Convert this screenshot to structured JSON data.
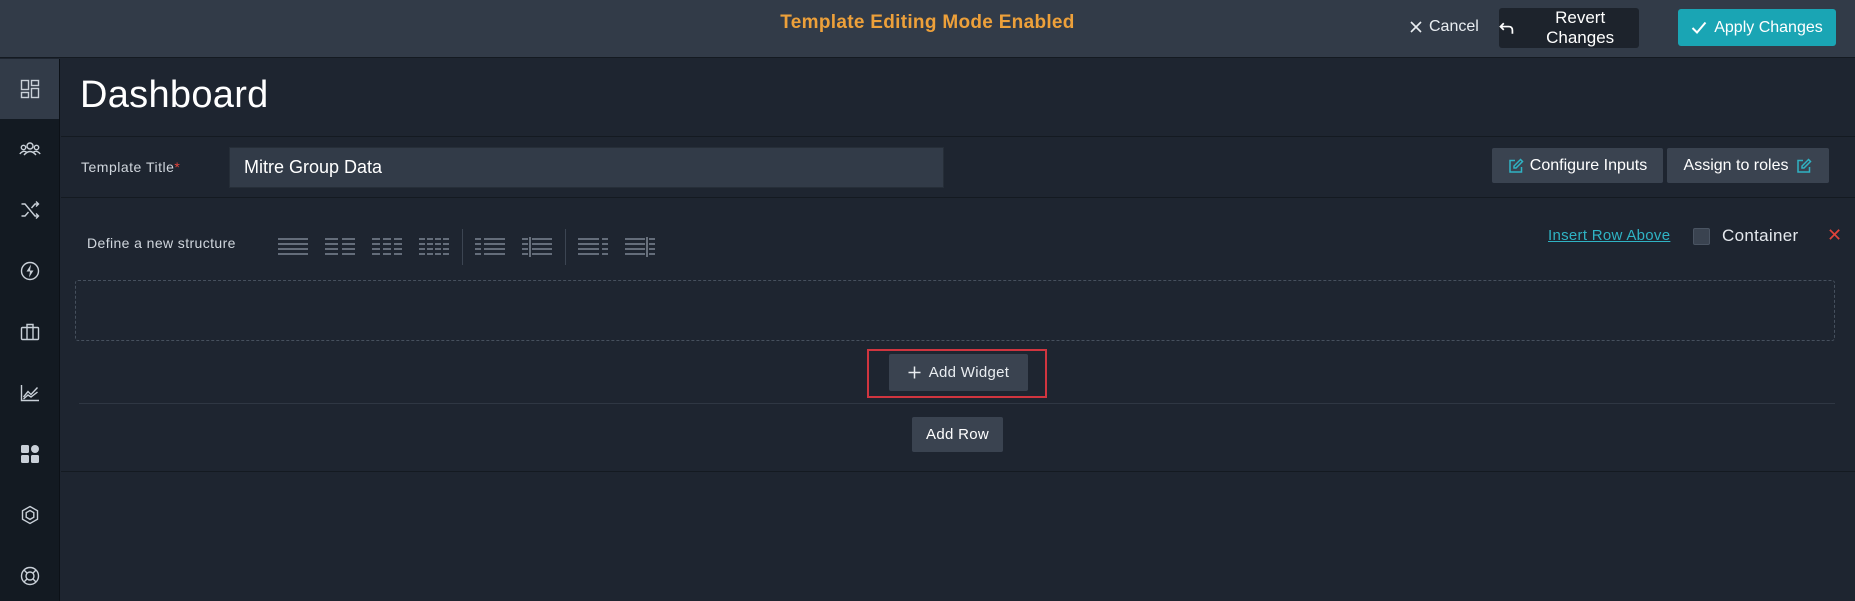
{
  "header": {
    "mode_text": "Template Editing Mode Enabled",
    "cancel_label": "Cancel",
    "revert_label": "Revert Changes",
    "apply_label": "Apply Changes"
  },
  "sidebar": {
    "icons": [
      "dashboard-icon",
      "group-icon",
      "shuffle-icon",
      "lightning-icon",
      "briefcase-icon",
      "chart-icon",
      "widgets-icon",
      "hexagon-icon",
      "lifebuoy-icon"
    ],
    "active_index": 0
  },
  "page": {
    "title": "Dashboard"
  },
  "template": {
    "label": "Template Title",
    "required_mark": "*",
    "value": "Mitre Group Data",
    "configure_inputs_label": "Configure Inputs",
    "assign_roles_label": "Assign to roles"
  },
  "structure": {
    "label": "Define a new structure",
    "insert_row_above_label": "Insert Row Above",
    "container_label": "Container",
    "container_checked": false,
    "remove_glyph": "✕",
    "add_widget_label": "Add Widget",
    "add_row_label": "Add Row"
  },
  "colors": {
    "accent": "#1aa5b4",
    "warning_text": "#eda03a",
    "danger": "#e0433a",
    "background": "#1e2530"
  }
}
